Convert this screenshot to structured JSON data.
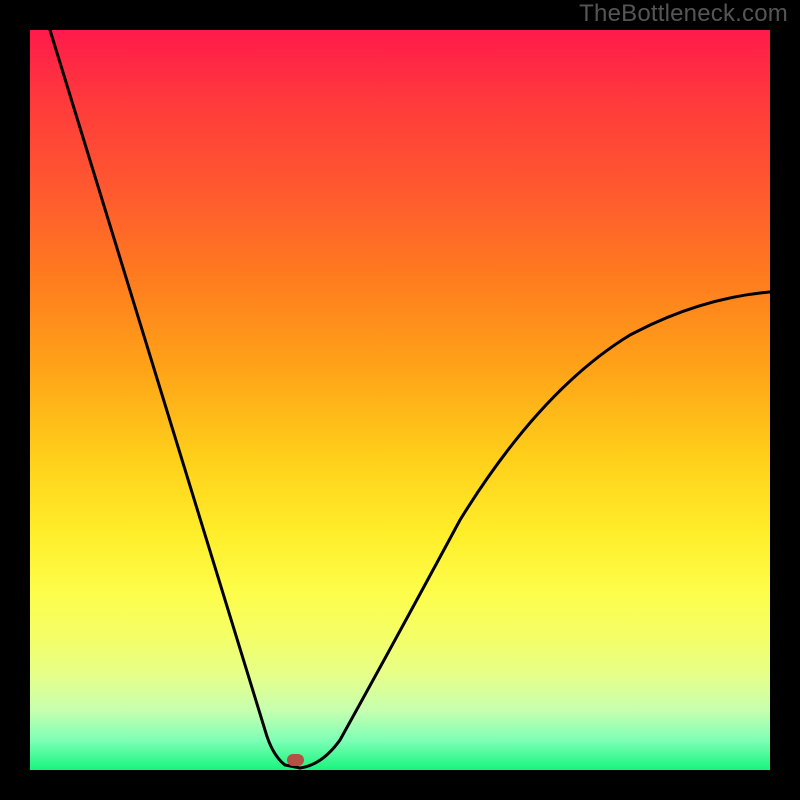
{
  "watermark": "TheBottleneck.com",
  "chart_data": {
    "type": "line",
    "title": "",
    "xlabel": "",
    "ylabel": "",
    "x_range": [
      0,
      1
    ],
    "y_range": [
      0,
      1
    ],
    "series": [
      {
        "name": "bottleneck-curve",
        "x": [
          0.03,
          0.33,
          0.36,
          0.4,
          1.0
        ],
        "y": [
          1.0,
          0.03,
          0.0,
          0.03,
          0.64
        ]
      }
    ],
    "marker": {
      "x": 0.36,
      "y": 0.0
    },
    "gradient": {
      "top_color": "#ff1a4b",
      "mid_color": "#ffee2a",
      "bottom_color": "#18f47d"
    },
    "background": "#000000"
  }
}
